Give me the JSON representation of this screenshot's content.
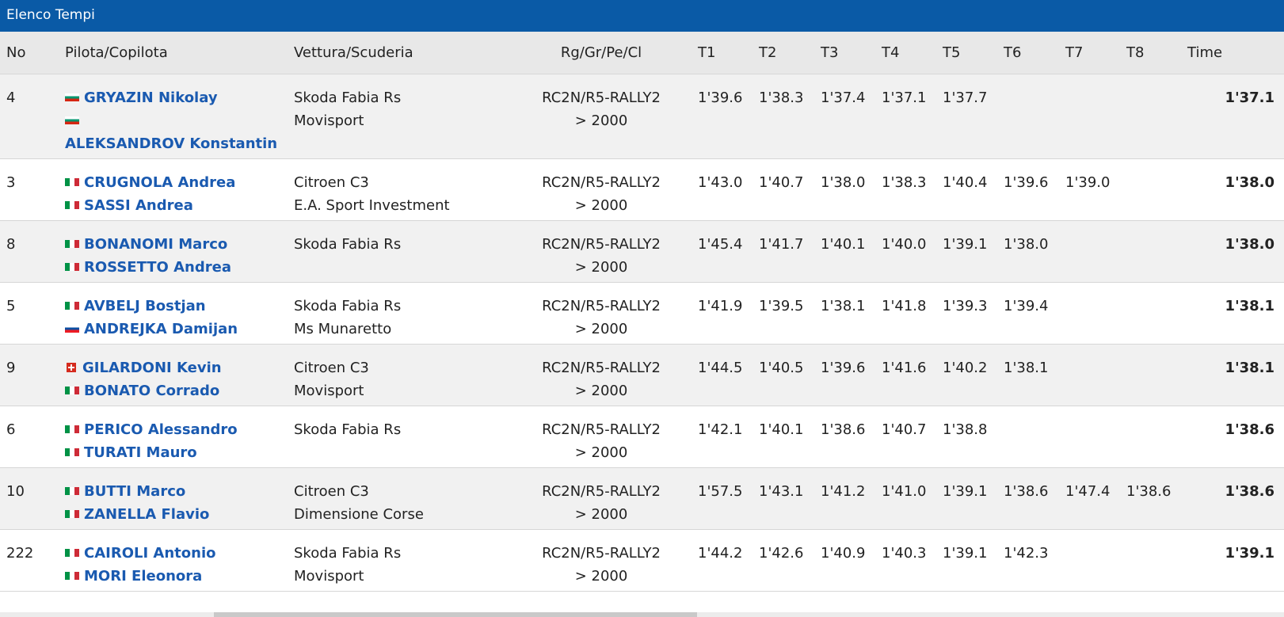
{
  "panel": {
    "title": "Elenco Tempi"
  },
  "columns": {
    "no": "No",
    "crew": "Pilota/Copilota",
    "car": "Vettura/Scuderia",
    "class": "Rg/Gr/Pe/Cl",
    "t1": "T1",
    "t2": "T2",
    "t3": "T3",
    "t4": "T4",
    "t5": "T5",
    "t6": "T6",
    "t7": "T7",
    "t8": "T8",
    "time": "Time"
  },
  "rows": [
    {
      "no": "4",
      "driver": {
        "name": "GRYAZIN Nikolay",
        "flag": "bulgaria-flag-icon"
      },
      "codriver": {
        "name": "ALEKSANDROV Konstantin",
        "flag": "bulgaria-flag-icon"
      },
      "car": "Skoda Fabia Rs",
      "team": "Movisport",
      "class_line1": "RC2N/R5-RALLY2",
      "class_line2": "> 2000",
      "t1": "1'39.6",
      "t2": "1'38.3",
      "t3": "1'37.4",
      "t4": "1'37.1",
      "t5": "1'37.7",
      "t6": "",
      "t7": "",
      "t8": "",
      "time": "1'37.1"
    },
    {
      "no": "3",
      "driver": {
        "name": "CRUGNOLA Andrea",
        "flag": "italy-flag-icon"
      },
      "codriver": {
        "name": "SASSI Andrea",
        "flag": "italy-flag-icon"
      },
      "car": "Citroen C3",
      "team": "E.A. Sport Investment",
      "class_line1": "RC2N/R5-RALLY2",
      "class_line2": "> 2000",
      "t1": "1'43.0",
      "t2": "1'40.7",
      "t3": "1'38.0",
      "t4": "1'38.3",
      "t5": "1'40.4",
      "t6": "1'39.6",
      "t7": "1'39.0",
      "t8": "",
      "time": "1'38.0"
    },
    {
      "no": "8",
      "driver": {
        "name": "BONANOMI Marco",
        "flag": "italy-flag-icon"
      },
      "codriver": {
        "name": "ROSSETTO Andrea",
        "flag": "italy-flag-icon"
      },
      "car": "Skoda Fabia Rs",
      "team": "",
      "class_line1": "RC2N/R5-RALLY2",
      "class_line2": "> 2000",
      "t1": "1'45.4",
      "t2": "1'41.7",
      "t3": "1'40.1",
      "t4": "1'40.0",
      "t5": "1'39.1",
      "t6": "1'38.0",
      "t7": "",
      "t8": "",
      "time": "1'38.0"
    },
    {
      "no": "5",
      "driver": {
        "name": "AVBELJ Bostjan",
        "flag": "italy-flag-icon"
      },
      "codriver": {
        "name": "ANDREJKA Damijan",
        "flag": "slovenia-flag-icon"
      },
      "car": "Skoda Fabia Rs",
      "team": "Ms Munaretto",
      "class_line1": "RC2N/R5-RALLY2",
      "class_line2": "> 2000",
      "t1": "1'41.9",
      "t2": "1'39.5",
      "t3": "1'38.1",
      "t4": "1'41.8",
      "t5": "1'39.3",
      "t6": "1'39.4",
      "t7": "",
      "t8": "",
      "time": "1'38.1"
    },
    {
      "no": "9",
      "driver": {
        "name": "GILARDONI Kevin",
        "flag": "switzerland-flag-icon"
      },
      "codriver": {
        "name": "BONATO Corrado",
        "flag": "italy-flag-icon"
      },
      "car": "Citroen C3",
      "team": "Movisport",
      "class_line1": "RC2N/R5-RALLY2",
      "class_line2": "> 2000",
      "t1": "1'44.5",
      "t2": "1'40.5",
      "t3": "1'39.6",
      "t4": "1'41.6",
      "t5": "1'40.2",
      "t6": "1'38.1",
      "t7": "",
      "t8": "",
      "time": "1'38.1"
    },
    {
      "no": "6",
      "driver": {
        "name": "PERICO Alessandro",
        "flag": "italy-flag-icon"
      },
      "codriver": {
        "name": "TURATI Mauro",
        "flag": "italy-flag-icon"
      },
      "car": "Skoda Fabia Rs",
      "team": "",
      "class_line1": "RC2N/R5-RALLY2",
      "class_line2": "> 2000",
      "t1": "1'42.1",
      "t2": "1'40.1",
      "t3": "1'38.6",
      "t4": "1'40.7",
      "t5": "1'38.8",
      "t6": "",
      "t7": "",
      "t8": "",
      "time": "1'38.6"
    },
    {
      "no": "10",
      "driver": {
        "name": "BUTTI Marco",
        "flag": "italy-flag-icon"
      },
      "codriver": {
        "name": "ZANELLA Flavio",
        "flag": "italy-flag-icon"
      },
      "car": "Citroen C3",
      "team": "Dimensione Corse",
      "class_line1": "RC2N/R5-RALLY2",
      "class_line2": "> 2000",
      "t1": "1'57.5",
      "t2": "1'43.1",
      "t3": "1'41.2",
      "t4": "1'41.0",
      "t5": "1'39.1",
      "t6": "1'38.6",
      "t7": "1'47.4",
      "t8": "1'38.6",
      "time": "1'38.6"
    },
    {
      "no": "222",
      "driver": {
        "name": "CAIROLI Antonio",
        "flag": "italy-flag-icon"
      },
      "codriver": {
        "name": "MORI Eleonora",
        "flag": "italy-flag-icon"
      },
      "car": "Skoda Fabia Rs",
      "team": "Movisport",
      "class_line1": "RC2N/R5-RALLY2",
      "class_line2": "> 2000",
      "t1": "1'44.2",
      "t2": "1'42.6",
      "t3": "1'40.9",
      "t4": "1'40.3",
      "t5": "1'39.1",
      "t6": "1'42.3",
      "t7": "",
      "t8": "",
      "time": "1'39.1"
    }
  ]
}
